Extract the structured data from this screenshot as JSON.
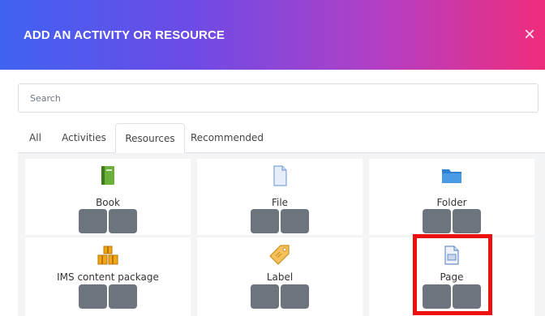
{
  "modal": {
    "title": "ADD AN ACTIVITY OR RESOURCE",
    "close_icon": "×"
  },
  "search": {
    "placeholder": "Search",
    "value": ""
  },
  "tabs": [
    {
      "label": "All",
      "active": false
    },
    {
      "label": "Activities",
      "active": false
    },
    {
      "label": "Resources",
      "active": true
    },
    {
      "label": "Recommended",
      "active": false
    }
  ],
  "tiles": [
    {
      "name": "Book",
      "icon": "book-icon"
    },
    {
      "name": "File",
      "icon": "file-icon"
    },
    {
      "name": "Folder",
      "icon": "folder-icon"
    },
    {
      "name": "IMS content package",
      "icon": "ims-package-icon"
    },
    {
      "name": "Label",
      "icon": "label-tag-icon"
    },
    {
      "name": "Page",
      "icon": "page-icon"
    }
  ],
  "colors": {
    "header_gradient": [
      "#3f63f1",
      "#6d4be6",
      "#b43fc4",
      "#ef2c7c"
    ],
    "button_gray": "#6c757d",
    "highlight": "#ee0f0f"
  }
}
